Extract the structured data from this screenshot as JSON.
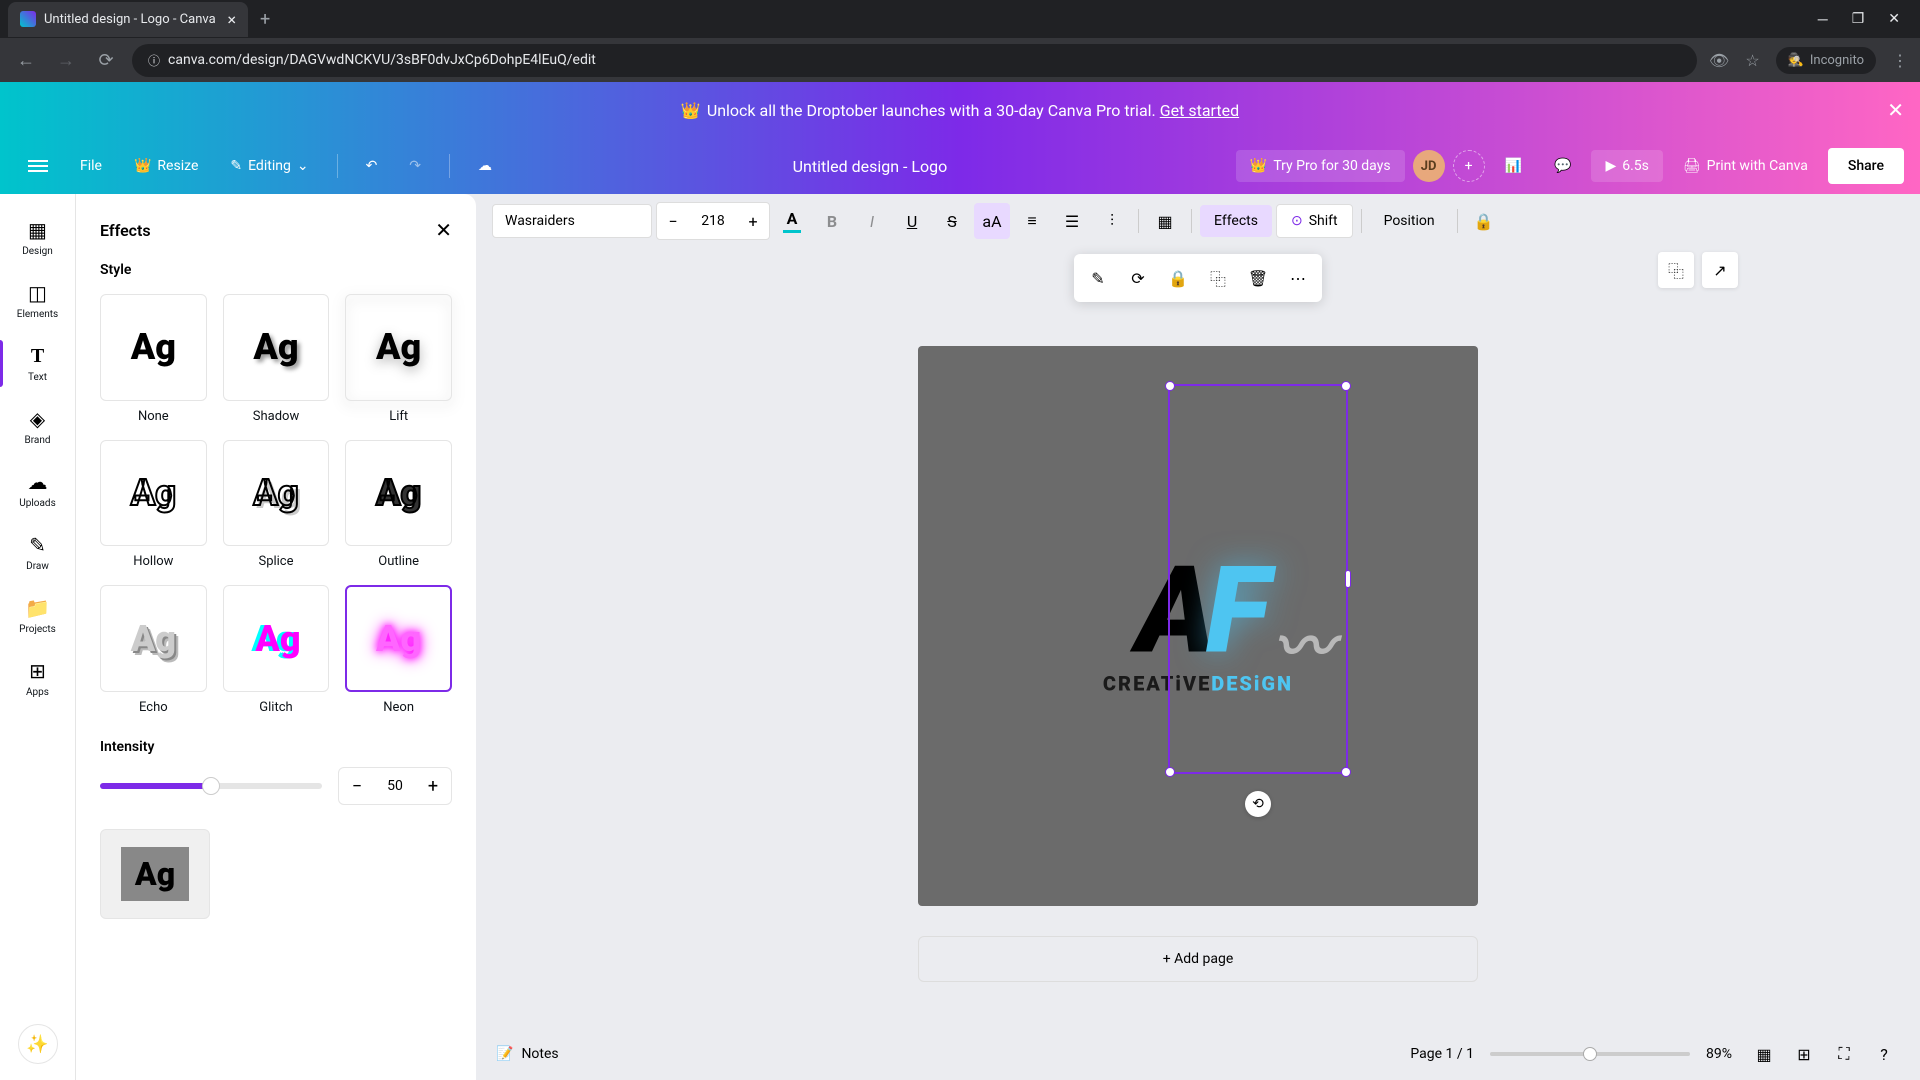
{
  "browser": {
    "tab_title": "Untitled design - Logo - Canva",
    "url": "canva.com/design/DAGVwdNCKVU/3sBF0dvJxCp6DohpE4lEuQ/edit",
    "incognito_label": "Incognito"
  },
  "banner": {
    "text": "Unlock all the Droptober launches with a 30-day Canva Pro trial.",
    "link": "Get started"
  },
  "toolbar": {
    "file": "File",
    "resize": "Resize",
    "editing": "Editing",
    "title": "Untitled design - Logo",
    "try_pro": "Try Pro for 30 days",
    "user_initials": "JD",
    "duration": "6.5s",
    "print": "Print with Canva",
    "share": "Share"
  },
  "left_nav": {
    "items": [
      {
        "label": "Design"
      },
      {
        "label": "Elements"
      },
      {
        "label": "Text"
      },
      {
        "label": "Brand"
      },
      {
        "label": "Uploads"
      },
      {
        "label": "Draw"
      },
      {
        "label": "Projects"
      },
      {
        "label": "Apps"
      }
    ]
  },
  "effects_panel": {
    "title": "Effects",
    "style_label": "Style",
    "styles": [
      {
        "label": "None"
      },
      {
        "label": "Shadow"
      },
      {
        "label": "Lift"
      },
      {
        "label": "Hollow"
      },
      {
        "label": "Splice"
      },
      {
        "label": "Outline"
      },
      {
        "label": "Echo"
      },
      {
        "label": "Glitch"
      },
      {
        "label": "Neon"
      }
    ],
    "selected_style": "Neon",
    "intensity_label": "Intensity",
    "intensity_value": "50",
    "sample_text": "Ag"
  },
  "text_toolbar": {
    "font": "Wasraiders",
    "size": "218",
    "effects_label": "Effects",
    "shift_label": "Shift",
    "position_label": "Position"
  },
  "canvas": {
    "logo_a": "A",
    "logo_f": "F",
    "sub_creative": "CREATiVE",
    "sub_design": "DESiGN",
    "add_page": "+ Add page"
  },
  "bottom": {
    "notes": "Notes",
    "page_info": "Page 1 / 1",
    "zoom": "89%"
  },
  "colors": {
    "accent": "#7d2ae8",
    "teal": "#00c4cc"
  }
}
